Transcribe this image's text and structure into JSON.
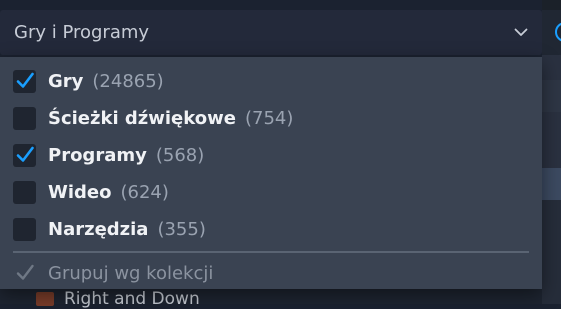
{
  "dropdown": {
    "selected_label": "Gry i Programy",
    "chevron_icon": "chevron-down-icon",
    "accent_color": "#1a9fff"
  },
  "options": [
    {
      "label": "Gry",
      "count": "(24865)",
      "checked": true
    },
    {
      "label": "Ścieżki dźwiękowe",
      "count": "(754)",
      "checked": false
    },
    {
      "label": "Programy",
      "count": "(568)",
      "checked": true
    },
    {
      "label": "Wideo",
      "count": "(624)",
      "checked": false
    },
    {
      "label": "Narzędzia",
      "count": "(355)",
      "checked": false
    }
  ],
  "group_option": {
    "label": "Grupuj wg kolekcji",
    "checked": true,
    "disabled": true
  },
  "background": {
    "partial_item_label": "Right and Down"
  }
}
